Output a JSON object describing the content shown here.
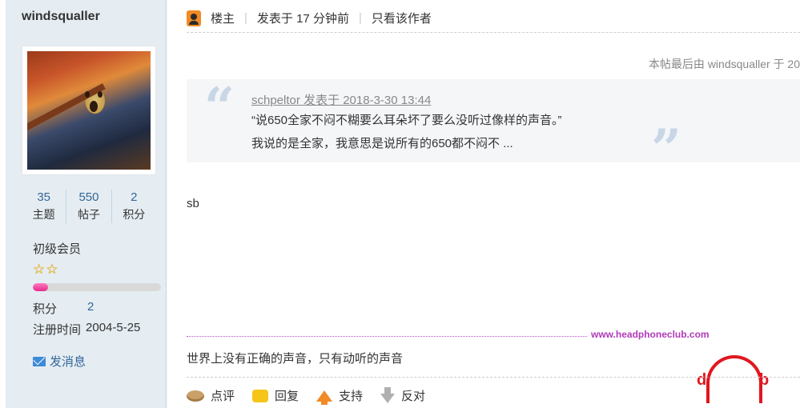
{
  "sidebar": {
    "username": "windsqualler",
    "stats": [
      {
        "num": "35",
        "label": "主题"
      },
      {
        "num": "550",
        "label": "帖子"
      },
      {
        "num": "2",
        "label": "积分"
      }
    ],
    "rank": "初级会员",
    "stars": 2,
    "progress_fraction": 0.12,
    "points_label": "积分",
    "points_value": "2",
    "register_label": "注册时间",
    "register_value": "2004-5-25",
    "message_label": "发消息"
  },
  "post": {
    "owner_label": "楼主",
    "posted_label": "发表于 17 分钟前",
    "only_author_label": "只看该作者",
    "edited_text": "本帖最后由 windsqualler 于 20",
    "quote": {
      "author_line": "schpeltor 发表于 2018-3-30 13:44",
      "line1": "“说650全家不闷不糊要么耳朵坏了要么没听过像样的声音。”",
      "line2": "我说的是全家，我意思是说所有的650都不闷不 ..."
    },
    "body": "sb",
    "signature_site": "www.headphoneclub.com",
    "signature_text": "世界上没有正确的声音，只有动听的声音",
    "logo_letters": {
      "left": "d",
      "right": "b"
    }
  },
  "actions": {
    "comment": "点评",
    "reply": "回复",
    "support": "支持",
    "oppose": "反对"
  },
  "colors": {
    "sidebar_bg": "#e5edf2",
    "link_blue": "#336699",
    "progress_pink": "#e62a8f",
    "logo_red": "#e0171f",
    "site_purple": "#b03ab8"
  }
}
